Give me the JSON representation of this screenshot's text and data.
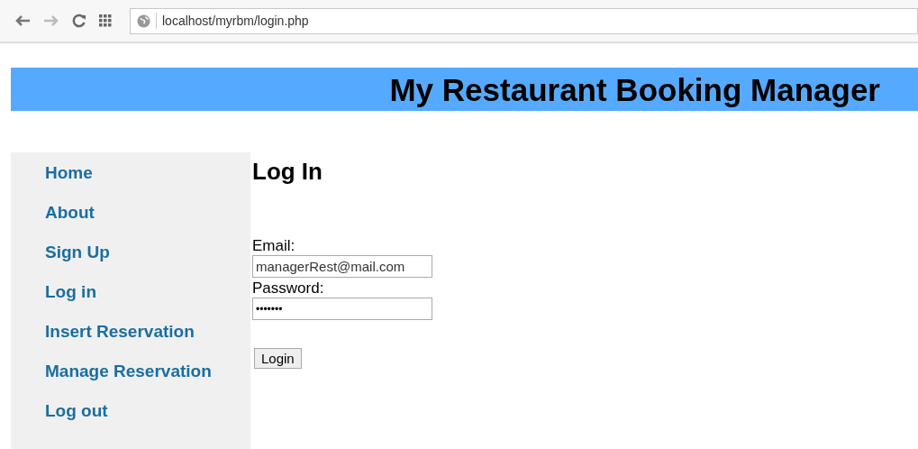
{
  "browser": {
    "url": "localhost/myrbm/login.php"
  },
  "header": {
    "title": "My Restaurant Booking Manager"
  },
  "sidebar": {
    "items": [
      {
        "label": "Home"
      },
      {
        "label": "About"
      },
      {
        "label": "Sign Up"
      },
      {
        "label": "Log in"
      },
      {
        "label": "Insert Reservation"
      },
      {
        "label": "Manage Reservation"
      },
      {
        "label": "Log out"
      }
    ]
  },
  "form": {
    "heading": "Log In",
    "email_label": "Email:",
    "email_value": "managerRest@mail.com",
    "password_label": "Password:",
    "password_value": "•••••••",
    "button": "Login"
  }
}
